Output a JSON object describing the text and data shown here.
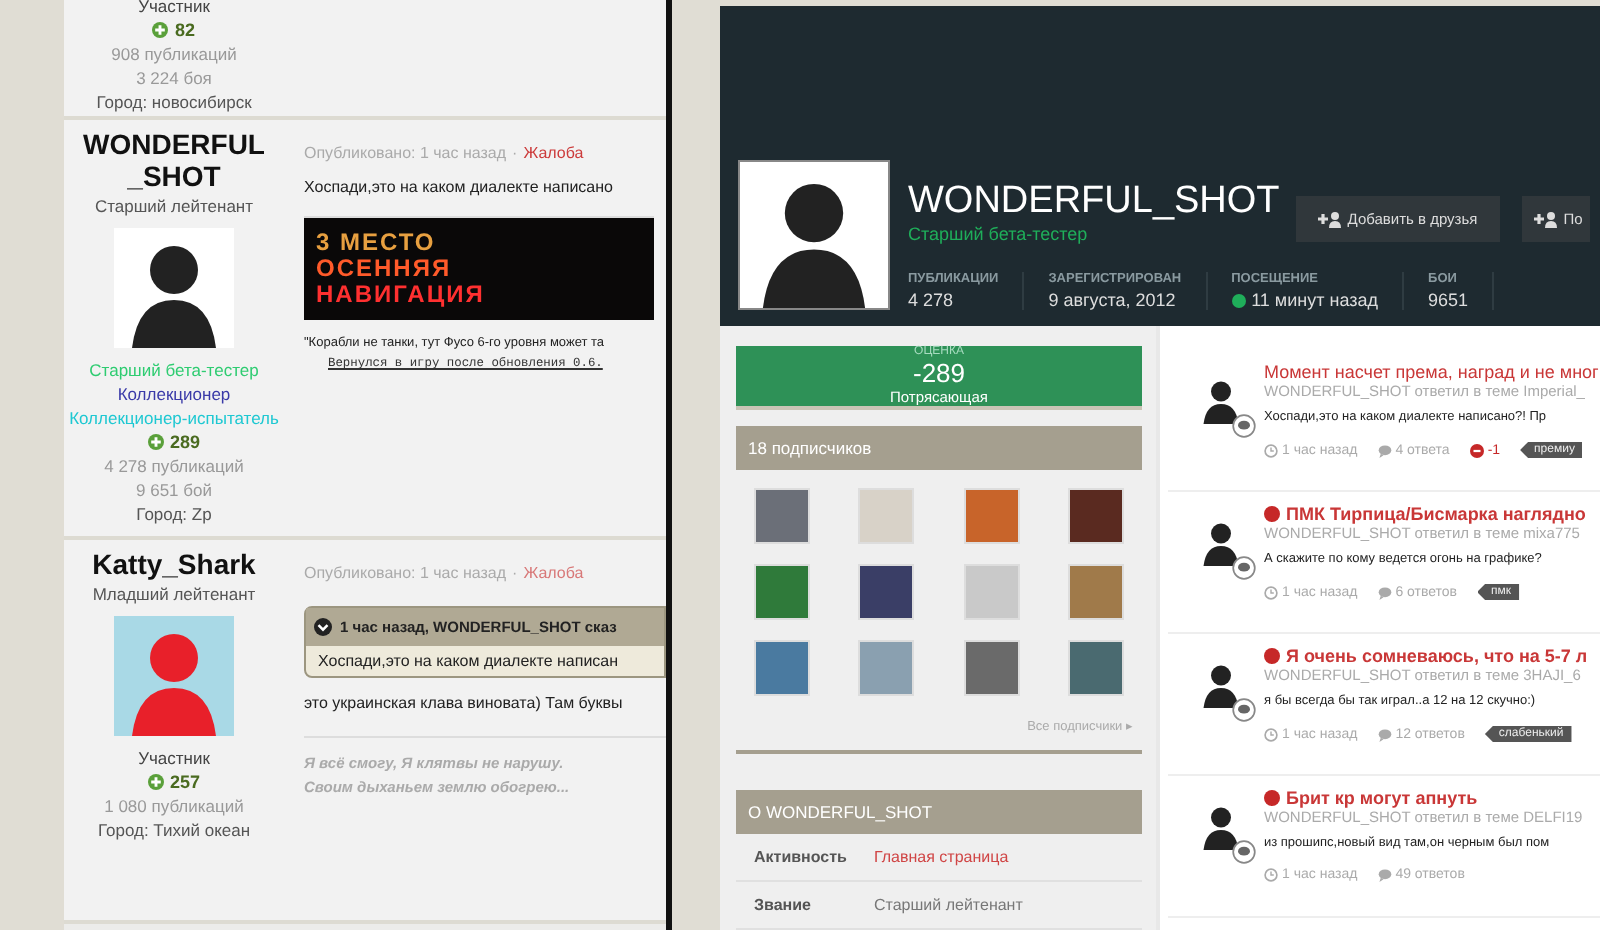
{
  "forum_thread": {
    "posts": [
      {
        "author": {
          "member_group": "Участник",
          "reputation": "82",
          "stats": [
            "908 публикаций",
            "3 224 боя"
          ],
          "city": "Город: новосибирск"
        }
      },
      {
        "author": {
          "name": "WONDERFUL_SHOT",
          "rank": "Старший лейтенант",
          "badges": [
            {
              "label": "Старший бета-тестер",
              "color": "#2ecc71"
            },
            {
              "label": "Коллекционер",
              "color": "#3a3aa8"
            },
            {
              "label": "Коллекционер-испытатель",
              "color": "#1ec8d2"
            }
          ],
          "reputation": "289",
          "stats": [
            "4 278 публикаций",
            "9 651 бой"
          ],
          "city": "Город: Zp"
        },
        "content": {
          "published": "Опубликовано: 1 час назад",
          "separator": "·",
          "report": "Жалоба",
          "report_dimmed": false,
          "blocks": [
            {
              "kind": "text",
              "text": "Хоспади,это на каком диалекте написано"
            },
            {
              "kind": "banner",
              "lines": [
                "3 МЕСТО",
                "ОСЕННЯЯ",
                "НАВИГАЦИЯ"
              ]
            },
            {
              "kind": "small",
              "text": "\"Корабли не танки, тут Фусо 6-го уровня может та"
            },
            {
              "kind": "link",
              "text": "Вернулся в игру после обновления 0.6."
            }
          ]
        }
      },
      {
        "author": {
          "name": "Katty_Shark",
          "rank": "Младший лейтенант",
          "member_group": "Участник",
          "reputation": "257",
          "stats": [
            "1 080 публикаций"
          ],
          "city": "Город: Тихий океан"
        },
        "content": {
          "published": "Опубликовано: 1 час назад",
          "separator": "·",
          "report": "Жалоба",
          "report_dimmed": true,
          "blocks": [
            {
              "kind": "quote",
              "header": "1 час назад, WONDERFUL_SHOT сказ",
              "text": "Хоспади,это на каком диалекте написан"
            },
            {
              "kind": "text",
              "text": "это украинская клава виновата) Там буквы"
            },
            {
              "kind": "signature",
              "lines": [
                "Я всё смогу, Я клятвы не нарушу.",
                "Своим дыханьем землю обогрею..."
              ]
            }
          ]
        }
      }
    ]
  },
  "profile": {
    "name": "WONDERFUL_SHOT",
    "title": "Старший бета-тестер",
    "buttons": [
      "Добавить в друзья",
      "По"
    ],
    "stats": [
      {
        "label": "ПУБЛИКАЦИИ",
        "value": "4 278",
        "online": false
      },
      {
        "label": "ЗАРЕГИСТРИРОВАН",
        "value": "9 августа, 2012",
        "online": false
      },
      {
        "label": "ПОСЕЩЕНИЕ",
        "value": "11 минут назад",
        "online": true
      },
      {
        "label": "БОИ",
        "value": "9651",
        "online": false
      }
    ]
  },
  "rating": {
    "label": "ОЦЕНКА",
    "value": "-289",
    "caption": "Потрясающая"
  },
  "followers": {
    "title": "18 подписчиков",
    "all_link": "Все подписчики ▸"
  },
  "about": {
    "title": "О WONDERFUL_SHOT",
    "rows": [
      {
        "label": "Активность",
        "value": "Главная страница",
        "link": true
      },
      {
        "label": "Звание",
        "value": "Старший лейтенант",
        "link": false
      }
    ]
  },
  "feed": [
    {
      "title": "Момент насчет према, наград и не мног",
      "unread": false,
      "byline": "WONDERFUL_SHOT ответил в теме Imperial_",
      "excerpt": "Хоспади,это на каком диалекте написано?! Пр",
      "time": "1 час назад",
      "replies": "4 ответа",
      "reputation": "-1",
      "tag": "премиу"
    },
    {
      "title": "ПМК Тирпица/Бисмарка наглядно",
      "unread": true,
      "byline": "WONDERFUL_SHOT ответил в теме mixa775",
      "excerpt": "А скажите по кому ведется огонь на графике?",
      "time": "1 час назад",
      "replies": "6 ответов",
      "tag": "пмк"
    },
    {
      "title": "Я очень сомневаюсь, что на 5-7 л",
      "unread": true,
      "byline": "WONDERFUL_SHOT ответил в теме 3HAJI_6",
      "excerpt": "я бы всегда бы так играл..а 12 на 12 скучно:)",
      "time": "1 час назад",
      "replies": "12 ответов",
      "tag": "слабенький"
    },
    {
      "title": "Брит кр могут апнуть",
      "unread": true,
      "byline": "WONDERFUL_SHOT ответил в теме DELFI19",
      "excerpt": "из прошипс,новый вид там,он черным был пом",
      "time": "1 час назад",
      "replies": "49 ответов"
    }
  ]
}
